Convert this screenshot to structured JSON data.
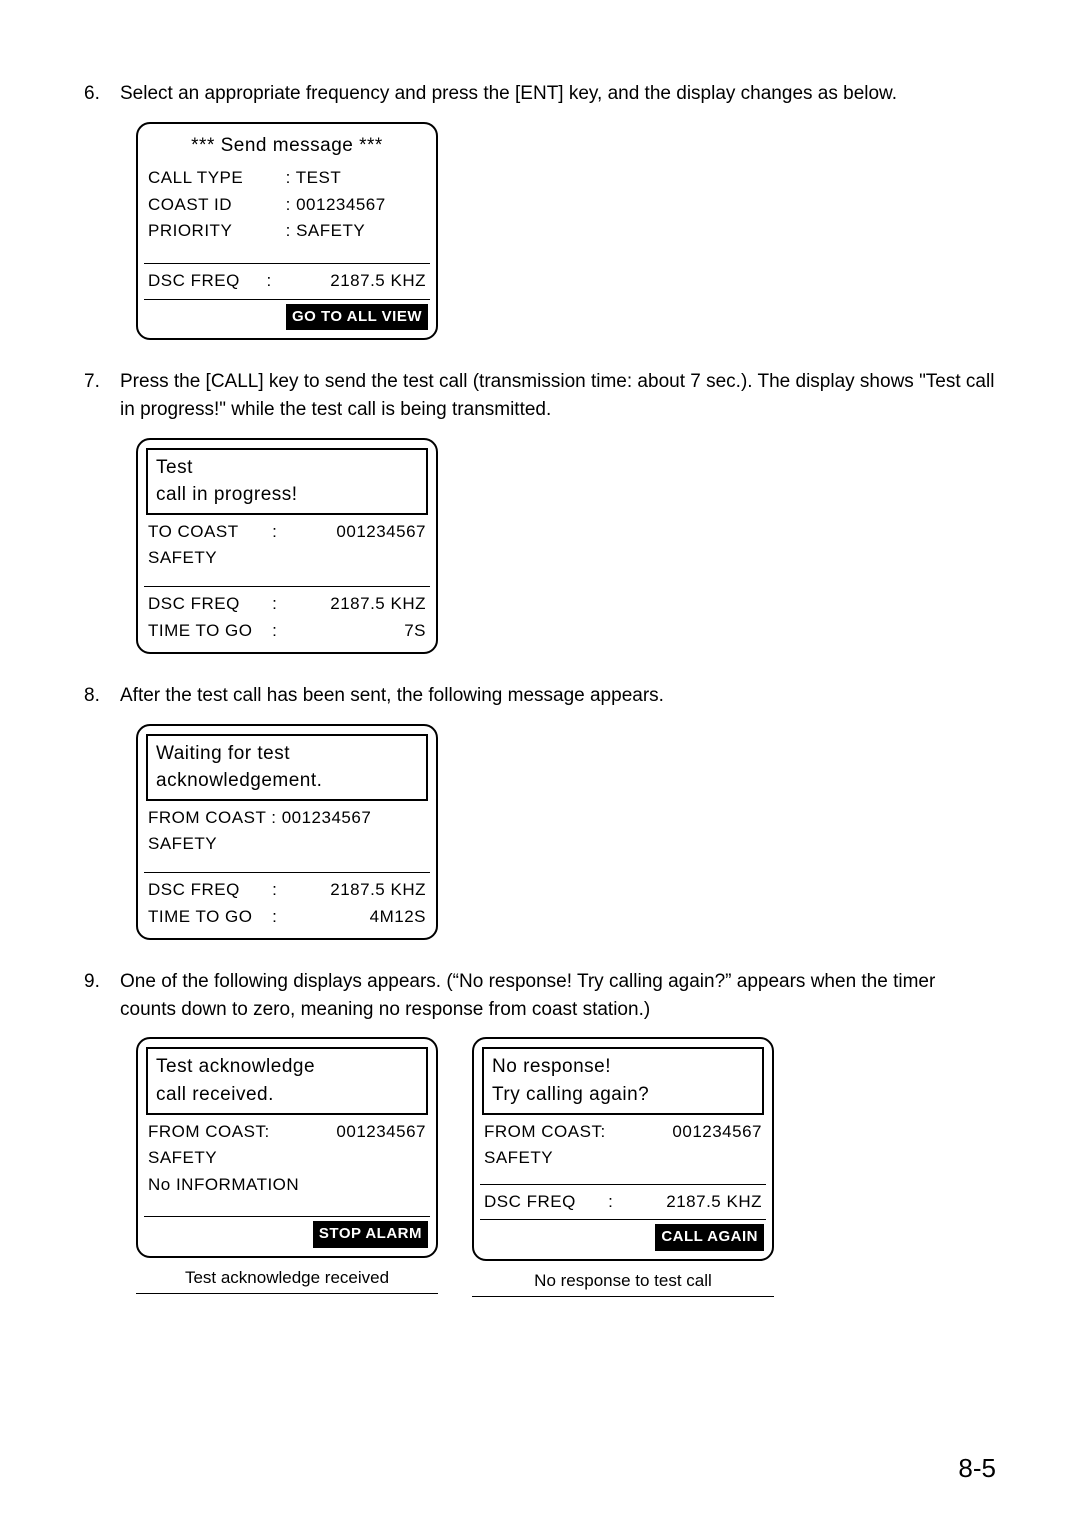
{
  "steps": {
    "s6": {
      "num": "6.",
      "text": "Select an appropriate frequency and press the [ENT] key, and the display changes as below."
    },
    "s7": {
      "num": "7.",
      "text": "Press the [CALL] key to send the test call (transmission time: about 7 sec.). The display shows \"Test call in progress!\" while the test call is being transmitted."
    },
    "s8": {
      "num": "8.",
      "text": "After the test call has been sent, the following message appears."
    },
    "s9": {
      "num": "9.",
      "text": "One of the following displays appears. (“No response! Try calling again?” appears when the timer counts down to zero, meaning no response from coast station.)"
    }
  },
  "screen1": {
    "title": "*** Send message ***",
    "rows": {
      "r1": {
        "k": "CALL TYPE",
        "v": ": TEST"
      },
      "r2": {
        "k": "COAST ID",
        "v": ": 001234567"
      },
      "r3": {
        "k": "PRIORITY",
        "v": ": SAFETY"
      },
      "r4": {
        "k": "DSC FREQ",
        "c": ":",
        "v": "2187.5 KHZ"
      }
    },
    "button": "GO TO ALL VIEW"
  },
  "screen2": {
    "title1": "Test",
    "title2": "call in progress!",
    "r1k": "TO COAST",
    "r1c": ":",
    "r1v": "001234567",
    "r2": "SAFETY",
    "r3k": "DSC FREQ",
    "r3c": ":",
    "r3v": "2187.5 KHZ",
    "r4k": "TIME TO GO",
    "r4c": ":",
    "r4v": "7S"
  },
  "screen3": {
    "title1": "Waiting for test",
    "title2": "acknowledgement.",
    "r1": "FROM COAST : 001234567",
    "r2": "SAFETY",
    "r3k": "DSC FREQ",
    "r3c": ":",
    "r3v": "2187.5 KHZ",
    "r4k": "TIME TO GO",
    "r4c": ":",
    "r4v": "4M12S"
  },
  "screen4": {
    "title1": "Test acknowledge",
    "title2": "call received.",
    "r1k": "FROM COAST:",
    "r1v": "001234567",
    "r2": "SAFETY",
    "r3": "No INFORMATION",
    "button": "STOP ALARM",
    "caption": "Test acknowledge received"
  },
  "screen5": {
    "title1": "No response!",
    "title2": "Try calling again?",
    "r1k": "FROM COAST:",
    "r1v": "001234567",
    "r2": "SAFETY",
    "r3k": "DSC FREQ",
    "r3c": ":",
    "r3v": "2187.5 KHZ",
    "button": "CALL AGAIN",
    "caption": "No response to test call"
  },
  "page_number": "8-5"
}
